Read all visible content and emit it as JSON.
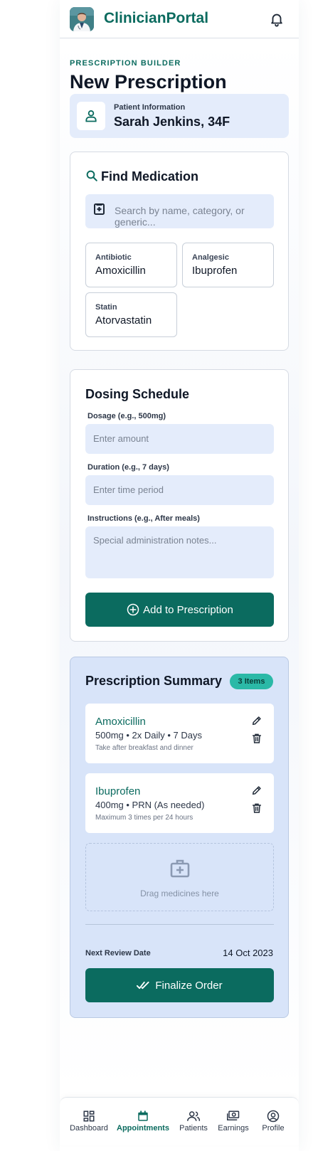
{
  "header": {
    "brand": "ClinicianPortal",
    "avatar": "doctor-avatar",
    "notification_icon": "bell-icon"
  },
  "page": {
    "eyebrow": "PRESCRIPTION BUILDER",
    "title": "New Prescription"
  },
  "patient": {
    "label": "Patient Information",
    "name": "Sarah Jenkins, 34F",
    "icon": "person-icon"
  },
  "find_medication": {
    "title": "Find Medication",
    "title_icon": "search-icon",
    "search_placeholder": "Search by name, category, or generic...",
    "search_icon": "medical-file-icon",
    "suggestions": [
      {
        "category": "Antibiotic",
        "name": "Amoxicillin"
      },
      {
        "category": "Analgesic",
        "name": "Ibuprofen"
      },
      {
        "category": "Statin",
        "name": "Atorvastatin"
      }
    ]
  },
  "dosing": {
    "title": "Dosing Schedule",
    "dosage_label": "Dosage (e.g., 500mg)",
    "dosage_placeholder": "Enter amount",
    "duration_label": "Duration (e.g., 7 days)",
    "duration_placeholder": "Enter time period",
    "instructions_label": "Instructions (e.g., After meals)",
    "instructions_placeholder": "Special administration notes...",
    "add_button": "Add to Prescription",
    "add_icon": "plus-circle-icon"
  },
  "summary": {
    "title": "Prescription Summary",
    "count_badge": "3 Items",
    "items": [
      {
        "name": "Amoxicillin",
        "dose": "500mg • 2x Daily • 7 Days",
        "note": "Take after breakfast and dinner"
      },
      {
        "name": "Ibuprofen",
        "dose": "400mg • PRN (As needed)",
        "note": "Maximum 3 times per 24 hours"
      }
    ],
    "dropzone_text": "Drag medicines here",
    "review_label": "Next Review Date",
    "review_date": "14 Oct 2023",
    "finalize_button": "Finalize Order",
    "finalize_icon": "double-check-icon"
  },
  "nav": {
    "active": "Appointments",
    "items": [
      {
        "label": "Dashboard",
        "icon": "dashboard-icon"
      },
      {
        "label": "Appointments",
        "icon": "calendar-icon"
      },
      {
        "label": "Patients",
        "icon": "patients-icon"
      },
      {
        "label": "Earnings",
        "icon": "cash-icon"
      },
      {
        "label": "Profile",
        "icon": "profile-icon"
      }
    ]
  },
  "colors": {
    "brand": "#0b6b5f",
    "input_bg": "#e4ecfb",
    "summary_bg": "#d8e4f9",
    "badge": "#2bb9a7"
  }
}
